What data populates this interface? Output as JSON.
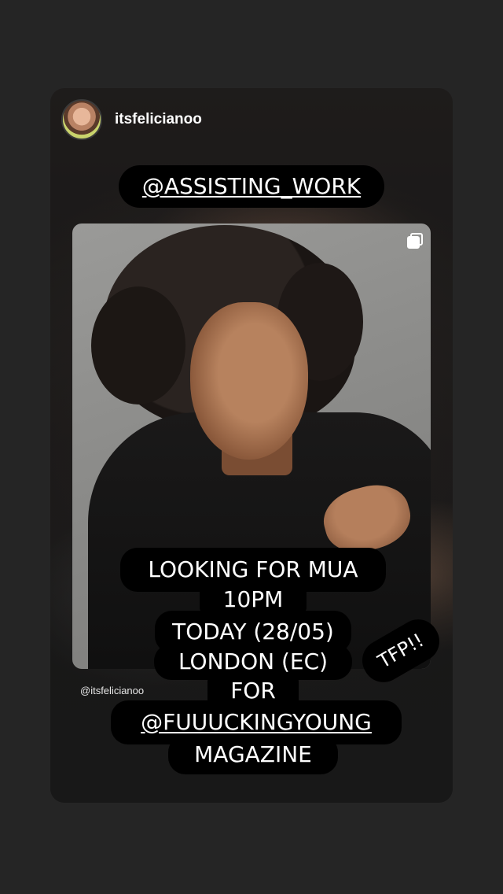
{
  "story": {
    "username": "itsfelicianoo",
    "mention_sticker": "@ASSISTING_WORK",
    "photo_credit": "@itsfelicianoo",
    "text_lines": [
      "LOOKING FOR MUA",
      "10PM",
      "TODAY (28/05)",
      "LONDON (EC)",
      "FOR",
      "@FUUUCKINGYOUNG",
      "MAGAZINE"
    ],
    "tfp_sticker": "TFP!!"
  },
  "icons": {
    "multi_post": "carousel-icon"
  },
  "colors": {
    "background": "#252525",
    "sticker_bg": "#000000",
    "text": "#ffffff"
  }
}
